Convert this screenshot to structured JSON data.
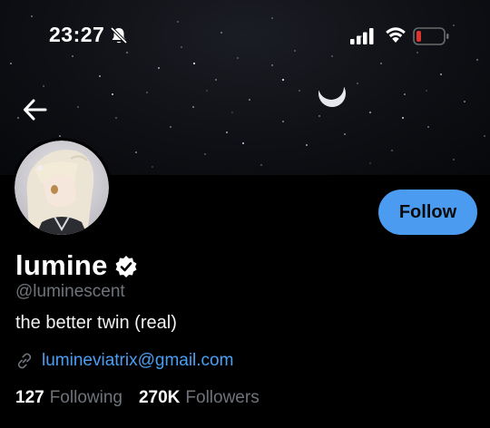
{
  "status_bar": {
    "time": "23:27",
    "battery_color": "#e0322e"
  },
  "banner": {
    "background": "starry night sky with crescent moon"
  },
  "profile": {
    "display_name": "lumine",
    "handle": "@luminescent",
    "bio": "the better twin (real)",
    "link": "lumineviatrix@gmail.com",
    "following_count": "127",
    "following_label": "Following",
    "followers_count": "270K",
    "followers_label": "Followers"
  },
  "actions": {
    "follow_label": "Follow"
  },
  "colors": {
    "accent": "#4b9cf0",
    "link": "#4a9ff5",
    "muted": "#6f737a"
  },
  "icons": {
    "back": "arrow-left-icon",
    "verified": "verified-badge-icon",
    "link": "link-icon",
    "bell": "bell-slash-icon",
    "signal": "signal-icon",
    "wifi": "wifi-icon",
    "battery": "battery-icon"
  }
}
